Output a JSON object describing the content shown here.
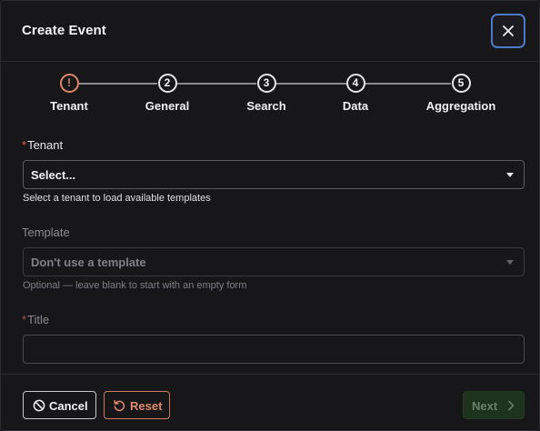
{
  "dialog": {
    "title": "Create Event",
    "close_icon": "close-icon"
  },
  "stepper": {
    "steps": [
      {
        "marker": "!",
        "label": "Tenant",
        "state": "error"
      },
      {
        "marker": "2",
        "label": "General",
        "state": "pending"
      },
      {
        "marker": "3",
        "label": "Search",
        "state": "pending"
      },
      {
        "marker": "4",
        "label": "Data",
        "state": "pending"
      },
      {
        "marker": "5",
        "label": "Aggregation",
        "state": "pending"
      }
    ]
  },
  "form": {
    "required_mark": "*",
    "tenant": {
      "label": "Tenant",
      "value": "Select...",
      "helper": "Select a tenant to load available templates"
    },
    "template": {
      "label": "Template",
      "value": "Don't use a template",
      "helper": "Optional — leave blank to start with an empty form"
    },
    "title": {
      "label": "Title",
      "value": ""
    }
  },
  "footer": {
    "cancel_label": "Cancel",
    "reset_label": "Reset",
    "next_label": "Next"
  },
  "colors": {
    "accent": "#4d7ac7",
    "error": "#dd8768",
    "required": "#e0604f",
    "next_disabled_bg": "#1d331e"
  }
}
